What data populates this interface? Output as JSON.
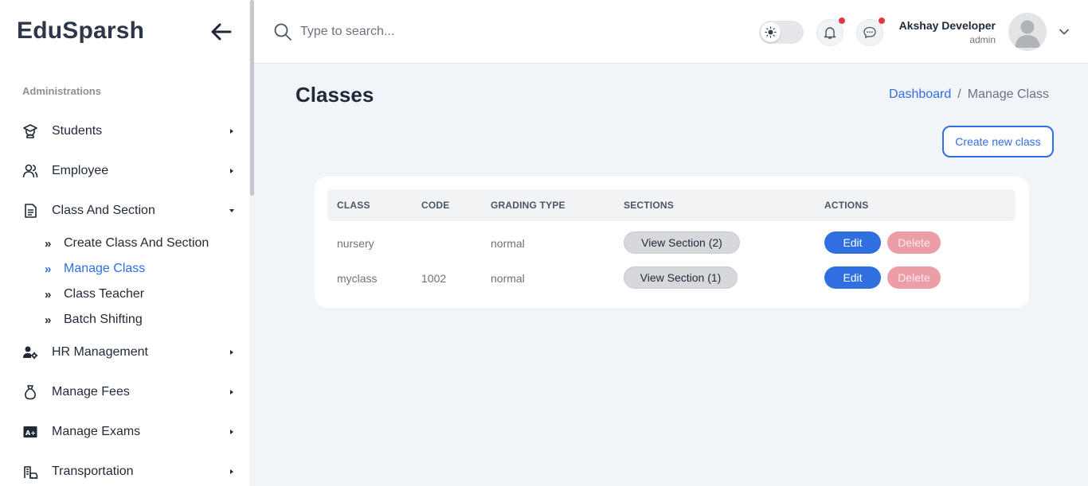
{
  "sidebar": {
    "brand": "EduSparsh",
    "section_label": "Administrations",
    "items": [
      {
        "label": "Students",
        "icon": "graduate-icon"
      },
      {
        "label": "Employee",
        "icon": "users-icon"
      },
      {
        "label": "Class And Section",
        "icon": "document-icon",
        "expanded": true
      },
      {
        "label": "HR Management",
        "icon": "user-gear-icon"
      },
      {
        "label": "Manage Fees",
        "icon": "money-bag-icon"
      },
      {
        "label": "Manage Exams",
        "icon": "grade-icon"
      },
      {
        "label": "Transportation",
        "icon": "transport-icon"
      }
    ],
    "sub_items": [
      {
        "label": "Create Class And Section",
        "active": false
      },
      {
        "label": "Manage Class",
        "active": true
      },
      {
        "label": "Class Teacher",
        "active": false
      },
      {
        "label": "Batch Shifting",
        "active": false
      }
    ],
    "sub_icon": "»"
  },
  "header": {
    "search_placeholder": "Type to search...",
    "user_name": "Akshay Developer",
    "user_role": "admin"
  },
  "main": {
    "title": "Classes",
    "breadcrumb": {
      "home": "Dashboard",
      "separator": "/",
      "current": "Manage Class"
    },
    "create_button": "Create new class",
    "table": {
      "headers": [
        "CLASS",
        "CODE",
        "GRADING TYPE",
        "SECTIONS",
        "ACTIONS"
      ],
      "rows": [
        {
          "class": "nursery",
          "code": "",
          "grading": "normal",
          "sections": "View Section (2)",
          "edit": "Edit",
          "delete": "Delete"
        },
        {
          "class": "myclass",
          "code": "1002",
          "grading": "normal",
          "sections": "View Section (1)",
          "edit": "Edit",
          "delete": "Delete"
        }
      ]
    }
  },
  "colors": {
    "accent": "#2f6fe0",
    "delete": "#ec9ea7",
    "notification_dot": "#e23744",
    "background": "#f1f4f8"
  }
}
